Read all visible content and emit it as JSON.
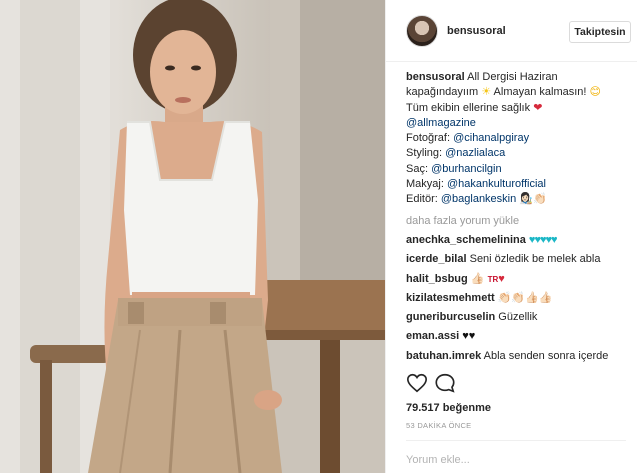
{
  "post": {
    "username": "bensusoral",
    "follow_label": "Takiptesin",
    "caption": {
      "username": "bensusoral",
      "line1_text": " All Dergisi Haziran",
      "line2_text": "kapağındayıım",
      "line2_emoji": "☀",
      "line2_after": " Almayan kalmasın!",
      "line2_emoji2": "😊",
      "line3_text": "Tüm ekibin ellerine sağlık",
      "line3_emoji": "❤",
      "mention_magazine": "@allmagazine",
      "photo_label": "Fotoğraf: ",
      "photo_mention": "@cihanalpgiray",
      "styling_label": "Styling: ",
      "styling_mention": "@nazlialaca",
      "hair_label": "Saç: ",
      "hair_mention": "@burhancilgin",
      "makeup_label": "Makyaj: ",
      "makeup_mention": "@hakankulturofficial",
      "editor_label": "Editör: ",
      "editor_mention": "@baglankeskin",
      "editor_emoji": "👩🏻‍🎨👏🏻"
    },
    "load_more": "daha fazla yorum yükle",
    "comments": [
      {
        "user": "anechka_schemelinina",
        "text": " ",
        "emoji": "♥♥♥♥♥"
      },
      {
        "user": "icerde_bilal",
        "text": " Seni özledik be melek abla",
        "emoji": ""
      },
      {
        "user": "halit_bsbug",
        "text": " ",
        "emoji": "👍🏻",
        "flag": "TR",
        "heart": "♥"
      },
      {
        "user": "kizilatesmehmett",
        "text": " ",
        "emoji": "👏🏻👏🏻👍🏻👍🏻"
      },
      {
        "user": "guneriburcuselin",
        "text": " Güzellik",
        "emoji": ""
      },
      {
        "user": "eman.assi",
        "text": " ",
        "emoji": "♥♥"
      },
      {
        "user": "batuhan.imrek",
        "text": " Abla senden sonra içerde",
        "emoji": ""
      }
    ],
    "likes": "79.517 beğenme",
    "time": "53 DAKİKA ÖNCE",
    "add_comment_placeholder": "Yorum ekle...",
    "more_icon": "•••"
  },
  "colors": {
    "link": "#003569",
    "muted": "#999999",
    "border": "#efefef"
  },
  "icons": [
    "heart-icon",
    "comment-icon",
    "more-options-icon"
  ]
}
